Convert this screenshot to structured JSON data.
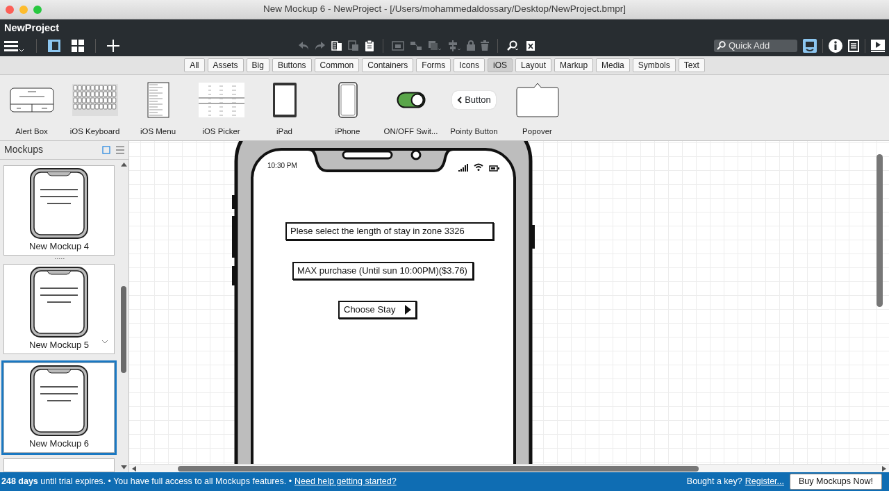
{
  "window": {
    "title": "New Mockup 6 - NewProject - [/Users/mohammedaldossary/Desktop/NewProject.bmpr]"
  },
  "app_bar": {
    "project": "NewProject",
    "quick_add": {
      "placeholder": "Quick Add"
    }
  },
  "categories": [
    {
      "label": "All",
      "selected": false
    },
    {
      "label": "Assets",
      "selected": false
    },
    {
      "label": "Big",
      "selected": false
    },
    {
      "label": "Buttons",
      "selected": false
    },
    {
      "label": "Common",
      "selected": false
    },
    {
      "label": "Containers",
      "selected": false
    },
    {
      "label": "Forms",
      "selected": false
    },
    {
      "label": "Icons",
      "selected": false
    },
    {
      "label": "iOS",
      "selected": true
    },
    {
      "label": "Layout",
      "selected": false
    },
    {
      "label": "Markup",
      "selected": false
    },
    {
      "label": "Media",
      "selected": false
    },
    {
      "label": "Symbols",
      "selected": false
    },
    {
      "label": "Text",
      "selected": false
    }
  ],
  "components": [
    {
      "label": "Alert Box",
      "kind": "alert"
    },
    {
      "label": "iOS Keyboard",
      "kind": "keyboard"
    },
    {
      "label": "iOS Menu",
      "kind": "menu"
    },
    {
      "label": "iOS Picker",
      "kind": "picker"
    },
    {
      "label": "iPad",
      "kind": "ipad"
    },
    {
      "label": "iPhone",
      "kind": "iphone"
    },
    {
      "label": "ON/OFF Swit...",
      "kind": "switch"
    },
    {
      "label": "Pointy Button",
      "kind": "pointy",
      "text": "Button"
    },
    {
      "label": "Popover",
      "kind": "popover"
    }
  ],
  "sidebar": {
    "title": "Mockups",
    "items": [
      {
        "label": "New Mockup 4",
        "selected": false
      },
      {
        "label": "New Mockup 5",
        "selected": false
      },
      {
        "label": "New Mockup 6",
        "selected": true
      }
    ]
  },
  "mockup": {
    "status_time": "10:30 PM",
    "elements": [
      {
        "kind": "label",
        "text": "Plese select the length of stay in zone 3326"
      },
      {
        "kind": "label",
        "text": "MAX purchase (Until sun 10:00PM)($3.76)"
      },
      {
        "kind": "button",
        "text": "Choose Stay"
      }
    ]
  },
  "status_bar": {
    "message": "**248 days** until trial expires. • You have full access to all Mockups features. •",
    "help_link": "Need help getting started?",
    "key_prompt": "Bought a key?",
    "register_link": "Register...",
    "buy_button": "Buy Mockups Now!"
  }
}
